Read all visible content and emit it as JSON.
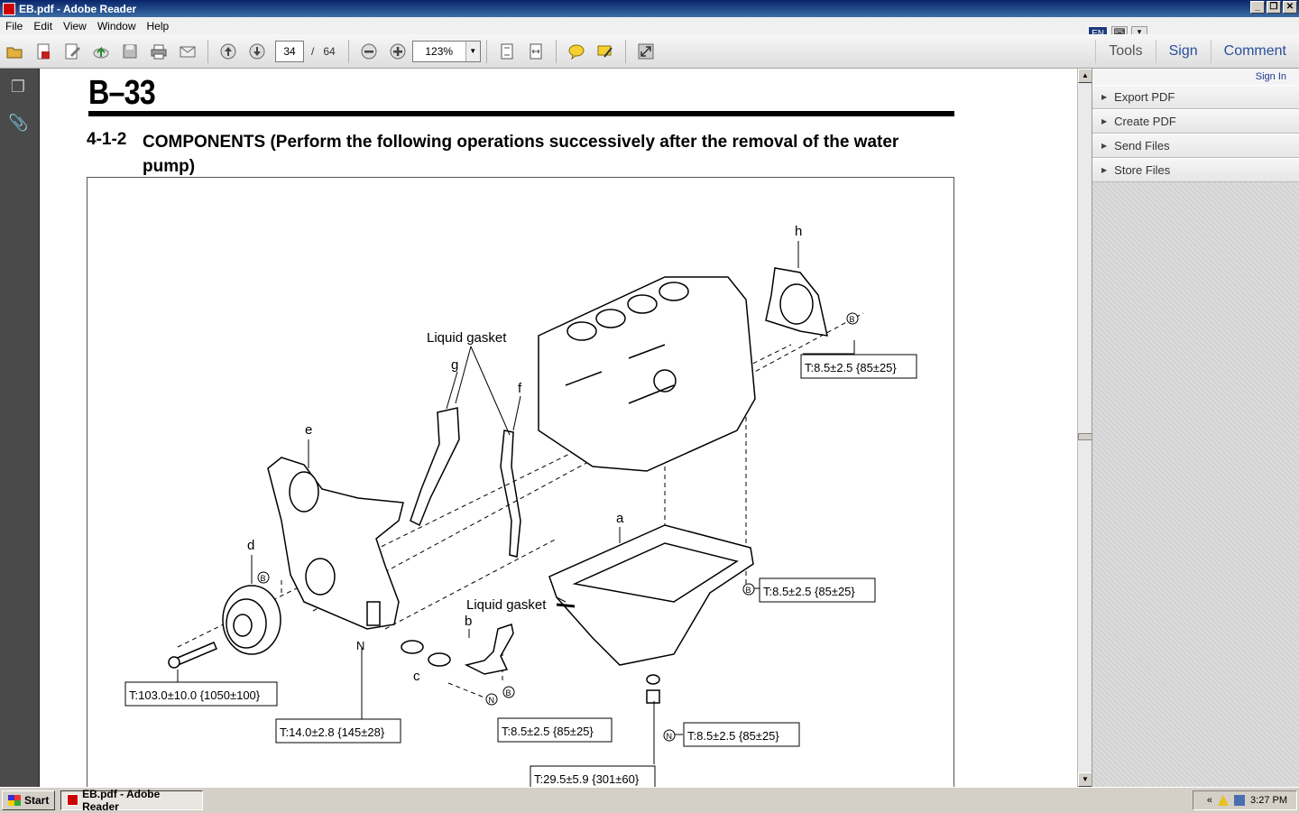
{
  "window": {
    "title": "EB.pdf - Adobe Reader"
  },
  "menu": [
    "File",
    "Edit",
    "View",
    "Window",
    "Help"
  ],
  "lang": {
    "code": "EN"
  },
  "toolbar": {
    "page_current": "34",
    "page_separator": "/",
    "page_total": "64",
    "zoom": "123%"
  },
  "right_tabs": {
    "tools": "Tools",
    "sign": "Sign",
    "comment": "Comment"
  },
  "side_panel": {
    "sign_in": "Sign In",
    "items": [
      "Export PDF",
      "Create PDF",
      "Send Files",
      "Store Files"
    ]
  },
  "document": {
    "page_label": "B–33",
    "section_number": "4-1-2",
    "section_title": "COMPONENTS (Perform the following operations successively after the removal of the water pump)",
    "labels": {
      "liquid_gasket_top": "Liquid gasket",
      "liquid_gasket_bottom": "Liquid gasket",
      "a": "a",
      "b": "b",
      "c": "c",
      "d": "d",
      "e": "e",
      "f": "f",
      "g": "g",
      "h": "h",
      "n": "N",
      "marker_b": "B",
      "marker_n": "N"
    },
    "torques": {
      "h": "T:8.5±2.5 {85±25}",
      "oil_pan": "T:8.5±2.5 {85±25}",
      "pulley": "T:103.0±10.0 {1050±100}",
      "cover": "T:14.0±2.8 {145±28}",
      "strainer": "T:8.5±2.5 {85±25}",
      "drain_n": "T:8.5±2.5 {85±25}",
      "drain_plug": "T:29.5±5.9 {301±60}"
    }
  },
  "taskbar": {
    "start": "Start",
    "task": "EB.pdf - Adobe Reader",
    "clock": "3:27 PM",
    "tray_expand": "«"
  }
}
